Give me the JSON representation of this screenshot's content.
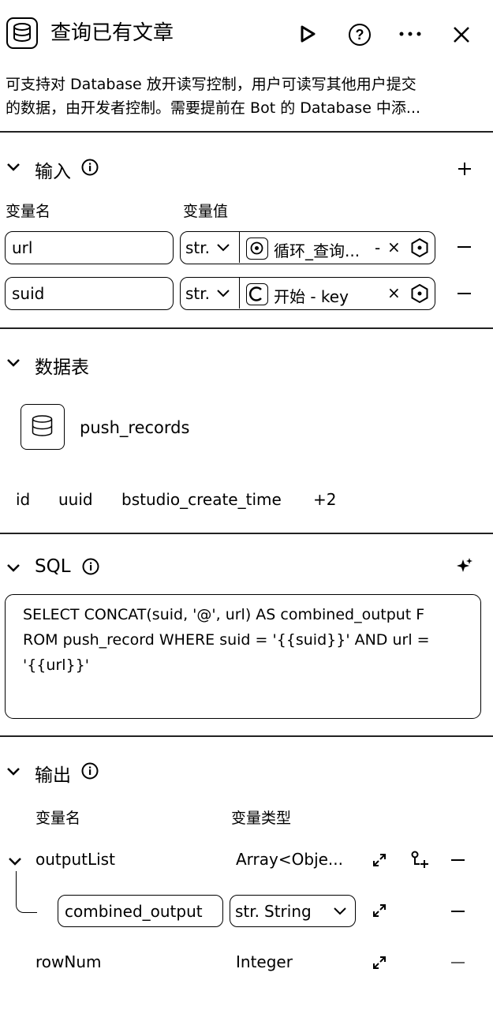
{
  "header": {
    "title": "查询已有文章",
    "description_line1": "可支持对 Database 放开读写控制，用户可读写其他用户提交",
    "description_line2": "的数据，由开发者控制。需要提前在 Bot 的 Database 中添..."
  },
  "input": {
    "title": "输入",
    "col_name": "变量名",
    "col_value": "变量值",
    "rows": [
      {
        "name": "url",
        "type": "str.",
        "value": "循环_查询...",
        "value_suffix": "-"
      },
      {
        "name": "suid",
        "type": "str.",
        "value": "开始 - key",
        "value_suffix": ""
      }
    ]
  },
  "table": {
    "title": "数据表",
    "name": "push_records",
    "columns": [
      "id",
      "uuid",
      "bstudio_create_time",
      "+2"
    ]
  },
  "sql": {
    "title": "SQL",
    "line1": "SELECT CONCAT(suid, '@', url) AS combined_output F",
    "line2": "ROM push_record WHERE suid = '{{suid}}' AND url =",
    "line3": "'{{url}}'"
  },
  "output": {
    "title": "输出",
    "col_name": "变量名",
    "col_type": "变量类型",
    "rows": [
      {
        "name": "outputList",
        "type": "Array<Obje..."
      },
      {
        "name": "combined_output",
        "type_prefix": "str.",
        "type": "String"
      },
      {
        "name": "rowNum",
        "type": "Integer"
      }
    ]
  },
  "icons": {
    "close": "×",
    "minus": "−",
    "plus": "+"
  }
}
